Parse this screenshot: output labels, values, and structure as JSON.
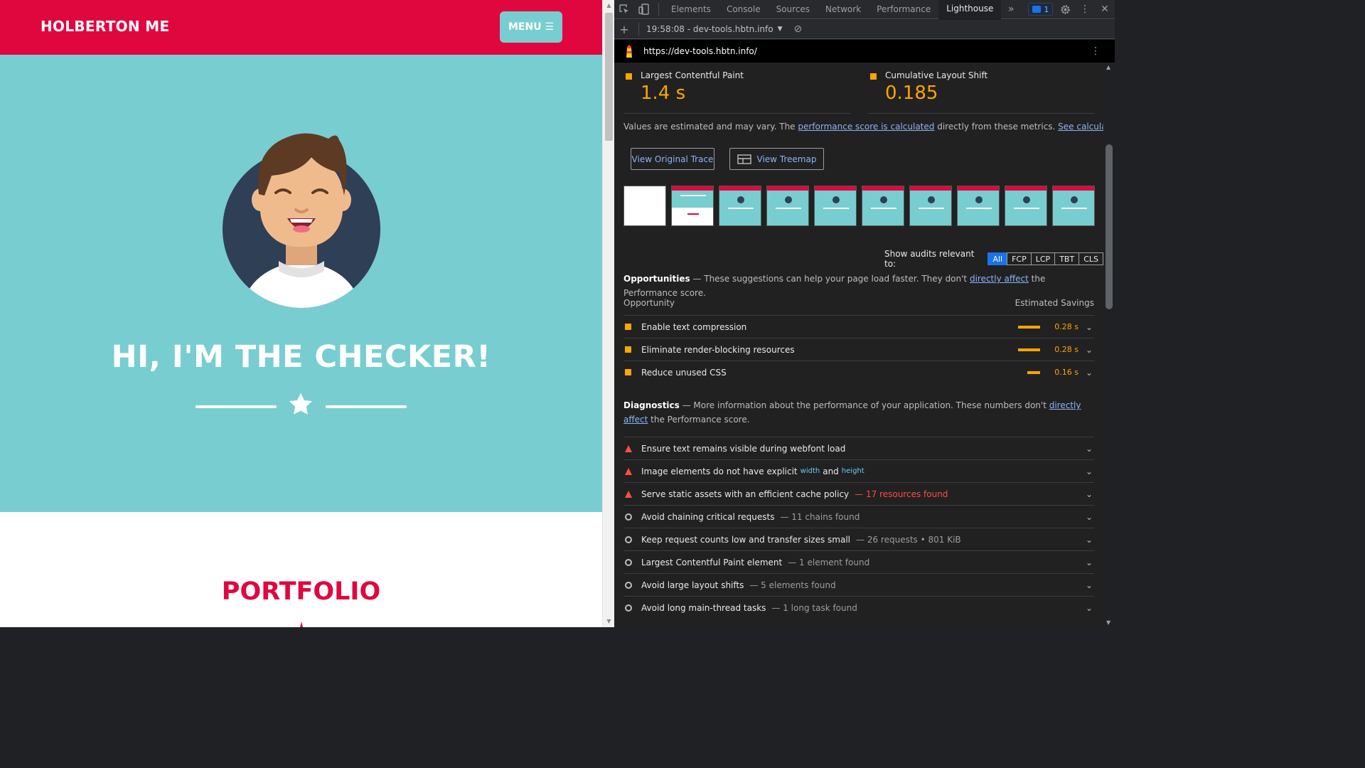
{
  "site": {
    "brand": "HOLBERTON ME",
    "menu_label": "MENU ☰",
    "hero_title": "HI, I'M THE CHECKER!",
    "portfolio_title": "PORTFOLIO"
  },
  "devtools": {
    "tabs": [
      "Elements",
      "Console",
      "Sources",
      "Network",
      "Performance",
      "Lighthouse"
    ],
    "active_tab": "Lighthouse",
    "messages_count": "1",
    "report_label": "19:58:08 - dev-tools.hbtn.info",
    "url": "https://dev-tools.hbtn.info/",
    "metrics": [
      {
        "label": "Largest Contentful Paint",
        "value": "1.4 s",
        "color": "#ffa400"
      },
      {
        "label": "Cumulative Layout Shift",
        "value": "0.185",
        "color": "#ffa400"
      }
    ],
    "values_note": {
      "a": "Values are estimated and may vary. The ",
      "link1": "performance score is calculated",
      "b": " directly from these metrics. ",
      "link2": "See calculator."
    },
    "buttons": {
      "trace": "View Original Trace",
      "treemap": "View Treemap"
    },
    "audit_filter": {
      "label": "Show audits relevant to:",
      "chips": [
        "All",
        "FCP",
        "LCP",
        "TBT",
        "CLS"
      ],
      "active": "All"
    },
    "opportunities": {
      "title": "Opportunities",
      "intro_a": " — These suggestions can help your page load faster. They don't ",
      "link": "directly affect",
      "intro_b": " the Performance score.",
      "col_left": "Opportunity",
      "col_right": "Estimated Savings",
      "items": [
        {
          "label": "Enable text compression",
          "savings": "0.28 s",
          "bar": 0.28
        },
        {
          "label": "Eliminate render-blocking resources",
          "savings": "0.28 s",
          "bar": 0.28
        },
        {
          "label": "Reduce unused CSS",
          "savings": "0.16 s",
          "bar": 0.16
        }
      ]
    },
    "diagnostics": {
      "title": "Diagnostics",
      "intro_a": " — More information about the performance of your application. These numbers don't ",
      "link": "directly affect",
      "intro_b": " the Performance score.",
      "items": [
        {
          "label": "Ensure text remains visible during webfont load",
          "detail": "",
          "status": "fail"
        },
        {
          "label": "Image elements do not have explicit",
          "code1": "width",
          "and": "and",
          "code2": "height",
          "status": "fail"
        },
        {
          "label": "Serve static assets with an efficient cache policy",
          "detail": "— 17 resources found",
          "status": "fail"
        },
        {
          "label": "Avoid chaining critical requests",
          "detail": "— 11 chains found",
          "status": "info"
        },
        {
          "label": "Keep request counts low and transfer sizes small",
          "detail": "— 26 requests • 801 KiB",
          "status": "info"
        },
        {
          "label": "Largest Contentful Paint element",
          "detail": "— 1 element found",
          "status": "info"
        },
        {
          "label": "Avoid large layout shifts",
          "detail": "— 5 elements found",
          "status": "info"
        },
        {
          "label": "Avoid long main-thread tasks",
          "detail": "— 1 long task found",
          "status": "info"
        }
      ]
    }
  },
  "colors": {
    "brand_red": "#e0073f",
    "teal": "#78cdd1",
    "warn": "#ffa400",
    "fail": "#ff4e42",
    "link": "#8ab4f8"
  }
}
